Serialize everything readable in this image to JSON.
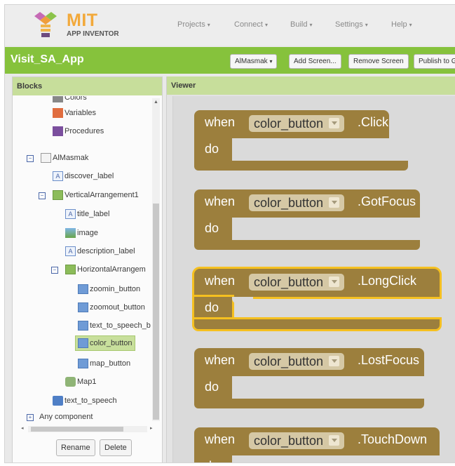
{
  "header": {
    "logo": {
      "mit": "MIT",
      "sub": "APP INVENTOR"
    },
    "nav": [
      {
        "label": "Projects"
      },
      {
        "label": "Connect"
      },
      {
        "label": "Build"
      },
      {
        "label": "Settings"
      },
      {
        "label": "Help"
      }
    ]
  },
  "project": {
    "title": "Visit_SA_App",
    "screen_select": "AlMasmak",
    "buttons": {
      "add_screen": "Add Screen...",
      "remove_screen": "Remove Screen",
      "publish": "Publish to G"
    }
  },
  "blocks_panel": {
    "title": "Blocks",
    "items": [
      {
        "label": "Colors",
        "icon": "colors-icon"
      },
      {
        "label": "Variables",
        "icon": "variables-icon",
        "color": "#e06d3f"
      },
      {
        "label": "Procedures",
        "icon": "procedures-icon",
        "color": "#7b4f9e"
      },
      {
        "label": "AlMasmak",
        "icon": "screen-icon"
      },
      {
        "label": "discover_label",
        "icon": "label-icon"
      },
      {
        "label": "VerticalArrangement1",
        "icon": "vertical-arrangement-icon"
      },
      {
        "label": "title_label",
        "icon": "label-icon"
      },
      {
        "label": "image",
        "icon": "image-icon"
      },
      {
        "label": "description_label",
        "icon": "label-icon"
      },
      {
        "label": "HorizontalArrangem",
        "icon": "horizontal-arrangement-icon"
      },
      {
        "label": "zoomin_button",
        "icon": "button-icon"
      },
      {
        "label": "zoomout_button",
        "icon": "button-icon"
      },
      {
        "label": "text_to_speech_b",
        "icon": "button-icon"
      },
      {
        "label": "color_button",
        "icon": "button-icon",
        "selected": true
      },
      {
        "label": "map_button",
        "icon": "button-icon"
      },
      {
        "label": "Map1",
        "icon": "map-icon"
      },
      {
        "label": "text_to_speech",
        "icon": "text-to-speech-icon"
      },
      {
        "label": "Any component",
        "icon": "any-component-icon"
      }
    ],
    "rename": "Rename",
    "delete": "Delete"
  },
  "viewer": {
    "title": "Viewer",
    "blocks": [
      {
        "when": "when",
        "component": "color_button",
        "event": ".Click",
        "do": "do",
        "selected": false
      },
      {
        "when": "when",
        "component": "color_button",
        "event": ".GotFocus",
        "do": "do",
        "selected": false
      },
      {
        "when": "when",
        "component": "color_button",
        "event": ".LongClick",
        "do": "do",
        "selected": true
      },
      {
        "when": "when",
        "component": "color_button",
        "event": ".LostFocus",
        "do": "do",
        "selected": false
      },
      {
        "when": "when",
        "component": "color_button",
        "event": ".TouchDown",
        "do": "do",
        "selected": false
      }
    ]
  },
  "colors": {
    "green_bar": "#86c23c",
    "blocks_header": "#c7de9b",
    "event_block": "#9c7f3d",
    "selection_outline": "#f5c020"
  }
}
